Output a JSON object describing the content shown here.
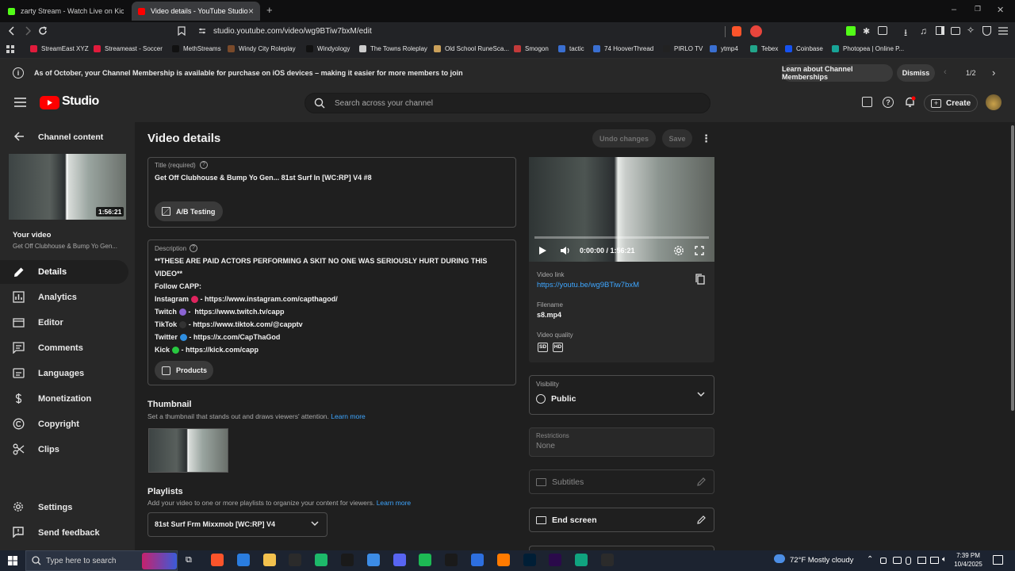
{
  "browser": {
    "tabs": [
      {
        "label": "zarty Stream - Watch Live on Kick",
        "active": false,
        "favicon_color": "#53fc18"
      },
      {
        "label": "Video details - YouTube Studio",
        "active": true,
        "favicon_color": "#ff0000"
      }
    ],
    "new_tab": "+",
    "url": "studio.youtube.com/video/wg9BTiw7bxM/edit",
    "bookmarks": [
      {
        "label": "StreamEast XYZ",
        "color": "#e01b3c"
      },
      {
        "label": "Streameast - Soccer",
        "color": "#e01b3c"
      },
      {
        "label": "MethStreams",
        "color": "#111111"
      },
      {
        "label": "Windy City Roleplay",
        "color": "#7a4a2a"
      },
      {
        "label": "Windyology",
        "color": "#111111"
      },
      {
        "label": "The Towns Roleplay",
        "color": "#cccccc"
      },
      {
        "label": "Old School RuneSca...",
        "color": "#caa05a"
      },
      {
        "label": "Smogon",
        "color": "#c23a3a"
      },
      {
        "label": "tactic",
        "color": "#3a6fd1"
      },
      {
        "label": "74 HooverThread",
        "color": "#3a6fd1"
      },
      {
        "label": "PIRLO TV",
        "color": "#222222"
      },
      {
        "label": "ytmp4",
        "color": "#3a6fd1"
      },
      {
        "label": "Tebex",
        "color": "#22a58a"
      },
      {
        "label": "Coinbase",
        "color": "#1652f0"
      },
      {
        "label": "Photopea | Online P...",
        "color": "#18a497"
      }
    ]
  },
  "banner": {
    "text": "As of October, your Channel Membership is available for purchase on iOS devices – making it easier for more members to join",
    "learn_button": "Learn about Channel Memberships",
    "dismiss_button": "Dismiss",
    "pager": "1/2"
  },
  "header": {
    "logo_text": "Studio",
    "search_placeholder": "Search across your channel",
    "create_label": "Create"
  },
  "sidebar": {
    "back_label": "Channel content",
    "duration": "1:56:21",
    "your_video_label": "Your video",
    "video_title": "Get Off Clubhouse & Bump Yo Gen...",
    "items": [
      {
        "label": "Details",
        "icon": "pencil-icon",
        "active": true
      },
      {
        "label": "Analytics",
        "icon": "analytics-icon",
        "active": false
      },
      {
        "label": "Editor",
        "icon": "editor-icon",
        "active": false
      },
      {
        "label": "Comments",
        "icon": "comments-icon",
        "active": false
      },
      {
        "label": "Languages",
        "icon": "languages-icon",
        "active": false
      },
      {
        "label": "Monetization",
        "icon": "dollar-icon",
        "active": false
      },
      {
        "label": "Copyright",
        "icon": "copyright-icon",
        "active": false
      },
      {
        "label": "Clips",
        "icon": "scissors-icon",
        "active": false
      }
    ],
    "settings_label": "Settings",
    "feedback_label": "Send feedback"
  },
  "details": {
    "page_title": "Video details",
    "undo_label": "Undo changes",
    "save_label": "Save",
    "title_label": "Title (required)",
    "title_value": "Get Off Clubhouse & Bump Yo Gen... 81st Surf In [WC:RP] V4 #8",
    "ab_testing_label": "A/B Testing",
    "description_label": "Description",
    "description_lines": [
      "**THESE ARE PAID ACTORS PERFORMING A SKIT NO ONE WAS SERIOUSLY HURT DURING THIS",
      "VIDEO**",
      "Follow CAPP:"
    ],
    "social_links": [
      {
        "name": "Instagram",
        "dot_color": "#e0245e",
        "sep": " - ",
        "url": "https://www.instagram.com/capthagod/"
      },
      {
        "name": "Twitch",
        "dot_color": "#8a63d2",
        "sep": " -  ",
        "url": "https://www.twitch.tv/capp"
      },
      {
        "name": "TikTok",
        "dot_color": "#333333",
        "sep": " - ",
        "url": "https://www.tiktok.com/@capptv"
      },
      {
        "name": "Twitter",
        "dot_color": "#2f8ee0",
        "sep": " - ",
        "url": "https://x.com/CapThaGod"
      },
      {
        "name": "Kick",
        "dot_color": "#28c840",
        "sep": " - ",
        "url": "https://kick.com/capp"
      }
    ],
    "products_label": "Products",
    "thumbnail_heading": "Thumbnail",
    "thumbnail_sub": "Set a thumbnail that stands out and draws viewers' attention.",
    "learn_more": "Learn more",
    "playlists_heading": "Playlists",
    "playlists_sub": "Add your video to one or more playlists to organize your content for viewers.",
    "playlist_value": "81st Surf Frm Mixxmob [WC:RP] V4"
  },
  "preview": {
    "time": "0:00:00 / 1:56:21",
    "video_link_label": "Video link",
    "video_link": "https://youtu.be/wg9BTiw7bxM",
    "filename_label": "Filename",
    "filename": "s8.mp4",
    "quality_label": "Video quality",
    "quality_sd": "SD",
    "quality_hd": "HD",
    "visibility_label": "Visibility",
    "visibility_value": "Public",
    "restrictions_label": "Restrictions",
    "restrictions_value": "None",
    "subtitles_label": "Subtitles",
    "end_screen_label": "End screen"
  },
  "taskbar": {
    "search_placeholder": "Type here to search",
    "weather": "72°F  Mostly cloudy",
    "time": "7:39 PM",
    "date": "10/4/2025"
  }
}
